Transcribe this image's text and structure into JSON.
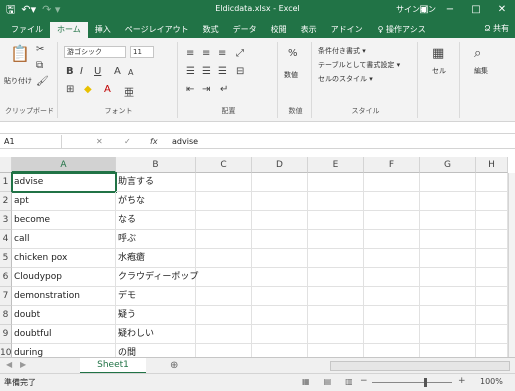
{
  "titlebar": {
    "save_icon": "save-icon",
    "undo_icon": "undo-icon",
    "title": "Eldicdata.xlsx - Excel",
    "signin": "サインイン",
    "ribbon_display_icon": "ribbon-display-icon",
    "minimize": "−",
    "maximize": "□",
    "close": "✕"
  },
  "tabs": [
    "ファイル",
    "ホーム",
    "挿入",
    "ページレイアウト",
    "数式",
    "データ",
    "校閲",
    "表示",
    "アドイン"
  ],
  "tell_me": "♀ 操作アシス",
  "share": "Ձ 共有",
  "ribbon": {
    "clipboard": {
      "paste": "貼り付け",
      "label": "クリップボード"
    },
    "font": {
      "name": "游ゴシック",
      "size": "11",
      "bold": "B",
      "italic": "I",
      "underline": "U",
      "grow": "A",
      "shrink": "A",
      "label": "フォント"
    },
    "alignment": {
      "label": "配置"
    },
    "number": {
      "percent": "%",
      "label": "数値"
    },
    "styles": {
      "conditional": "条件付き書式 ▾",
      "table": "テーブルとして書式設定 ▾",
      "cell_styles": "セルのスタイル ▾",
      "label": "スタイル"
    },
    "cells": {
      "label": "セル"
    },
    "editing": {
      "label": "編集"
    }
  },
  "formula_bar": {
    "name_box": "A1",
    "cancel": "✕",
    "enter": "✓",
    "fx": "fx",
    "value": "advise"
  },
  "columns": [
    "A",
    "B",
    "C",
    "D",
    "E",
    "F",
    "G",
    "H"
  ],
  "rows": [
    {
      "num": "1",
      "a": "advise",
      "b": "助言する"
    },
    {
      "num": "2",
      "a": "apt",
      "b": "がちな"
    },
    {
      "num": "3",
      "a": "become",
      "b": "なる"
    },
    {
      "num": "4",
      "a": "call",
      "b": "呼ぶ"
    },
    {
      "num": "5",
      "a": "chicken pox",
      "b": "水疱瘡"
    },
    {
      "num": "6",
      "a": "Cloudypop",
      "b": "クラウディーポップ"
    },
    {
      "num": "7",
      "a": "demonstration",
      "b": "デモ"
    },
    {
      "num": "8",
      "a": "doubt",
      "b": "疑う"
    },
    {
      "num": "9",
      "a": "doubtful",
      "b": "疑わしい"
    },
    {
      "num": "10",
      "a": "during",
      "b": "の間"
    }
  ],
  "sheet_tab": "Sheet1",
  "add_sheet": "⊕",
  "status": "準備完了",
  "zoom": "100%",
  "colors": {
    "excel_green": "#217346"
  }
}
